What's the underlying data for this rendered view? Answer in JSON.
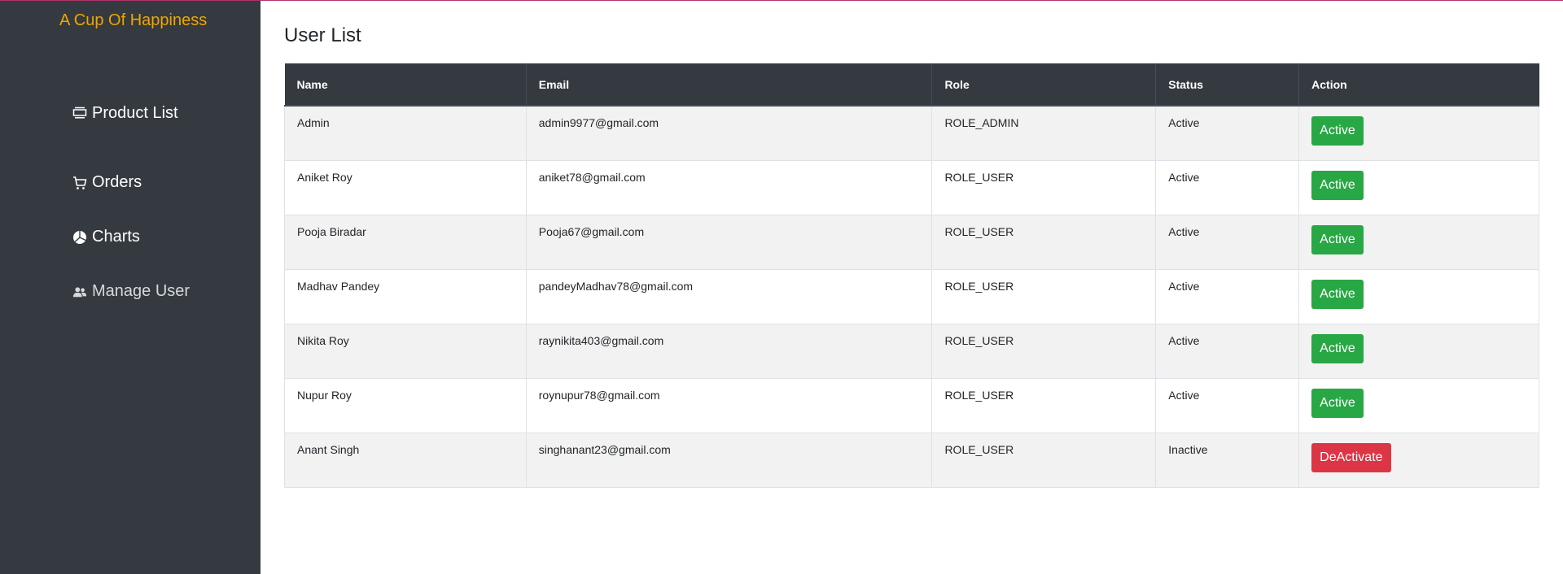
{
  "brand": {
    "title": "A Cup Of Happiness",
    "color": "#f0a500"
  },
  "sidebar": {
    "items": [
      {
        "label": "Product List",
        "icon": "list-icon"
      },
      {
        "label": "Orders",
        "icon": "cart-icon"
      },
      {
        "label": "Charts",
        "icon": "pie-chart-icon"
      },
      {
        "label": "Manage User",
        "icon": "users-icon"
      }
    ]
  },
  "main": {
    "title": "User List",
    "table": {
      "headers": {
        "name": "Name",
        "email": "Email",
        "role": "Role",
        "status": "Status",
        "action": "Action"
      },
      "rows": [
        {
          "name": "Admin",
          "email": "admin9977@gmail.com",
          "role": "ROLE_ADMIN",
          "status": "Active",
          "action": "Active",
          "action_style": "success"
        },
        {
          "name": "Aniket Roy",
          "email": "aniket78@gmail.com",
          "role": "ROLE_USER",
          "status": "Active",
          "action": "Active",
          "action_style": "success"
        },
        {
          "name": "Pooja Biradar",
          "email": "Pooja67@gmail.com",
          "role": "ROLE_USER",
          "status": "Active",
          "action": "Active",
          "action_style": "success"
        },
        {
          "name": "Madhav Pandey",
          "email": "pandeyMadhav78@gmail.com",
          "role": "ROLE_USER",
          "status": "Active",
          "action": "Active",
          "action_style": "success"
        },
        {
          "name": "Nikita Roy",
          "email": "raynikita403@gmail.com",
          "role": "ROLE_USER",
          "status": "Active",
          "action": "Active",
          "action_style": "success"
        },
        {
          "name": "Nupur Roy",
          "email": "roynupur78@gmail.com",
          "role": "ROLE_USER",
          "status": "Active",
          "action": "Active",
          "action_style": "success"
        },
        {
          "name": "Anant Singh",
          "email": "singhanant23@gmail.com",
          "role": "ROLE_USER",
          "status": "Inactive",
          "action": "DeActivate",
          "action_style": "danger"
        }
      ]
    }
  },
  "colors": {
    "sidebar_bg": "#343a40",
    "success": "#28a745",
    "danger": "#dc3545",
    "accent_line": "#b0346a"
  }
}
